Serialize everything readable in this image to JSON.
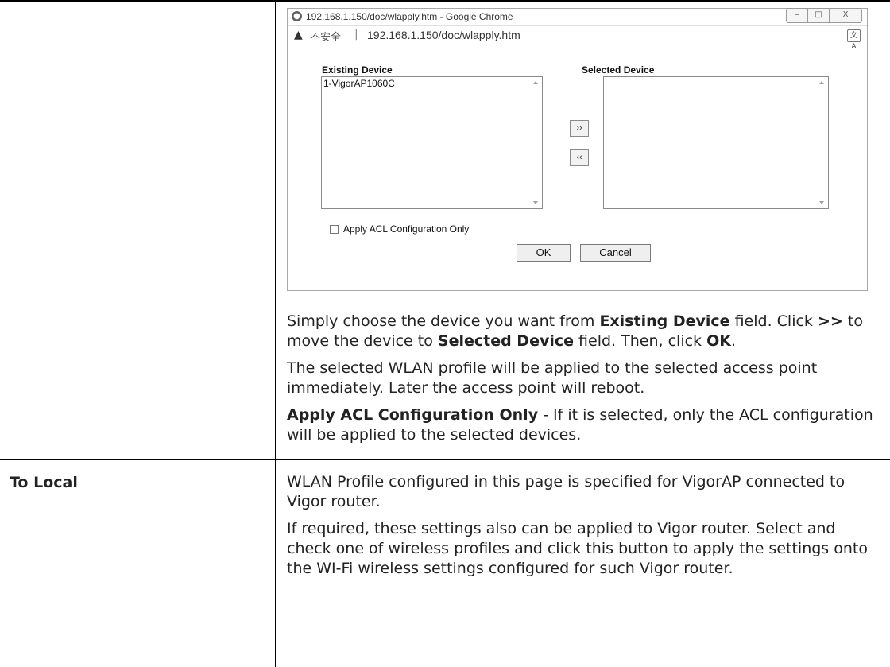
{
  "popup": {
    "window_title": "192.168.1.150/doc/wlapply.htm - Google Chrome",
    "window_controls": [
      "–",
      "□",
      "X"
    ],
    "security_warning": "不安全",
    "url": "192.168.1.150/doc/wlapply.htm",
    "existing_label": "Existing Device",
    "selected_label": "Selected Device",
    "existing_devices": [
      "1-VigorAP1060C"
    ],
    "move_right_label": "››",
    "move_left_label": "‹‹",
    "acl_checkbox_label": "Apply ACL Configuration Only",
    "acl_checked": false,
    "ok_label": "OK",
    "cancel_label": "Cancel"
  },
  "body_text": {
    "p1_a": "Simply choose the device you want from ",
    "p1_b": "Existing Device",
    "p1_c": " field. Click ",
    "p1_d": ">>",
    "p1_e": " to move the device to ",
    "p1_f": "Selected Device",
    "p1_g": " field. Then, click ",
    "p1_h": "OK",
    "p1_i": ".",
    "p2": "The selected WLAN profile will be applied to the selected access point immediately. Later the access point will reboot.",
    "p3_a": "Apply ACL Configuration Only",
    "p3_b": " - If it is selected, only the ACL configuration will be applied to the selected devices."
  },
  "to_local": {
    "label": "To Local",
    "p1": "WLAN Profile configured in this page is specified for VigorAP connected to Vigor router.",
    "p2": "If required, these settings also can be applied to Vigor router. Select and check one of wireless profiles and click this button to apply the settings onto the WI-Fi wireless settings configured for such Vigor router."
  }
}
